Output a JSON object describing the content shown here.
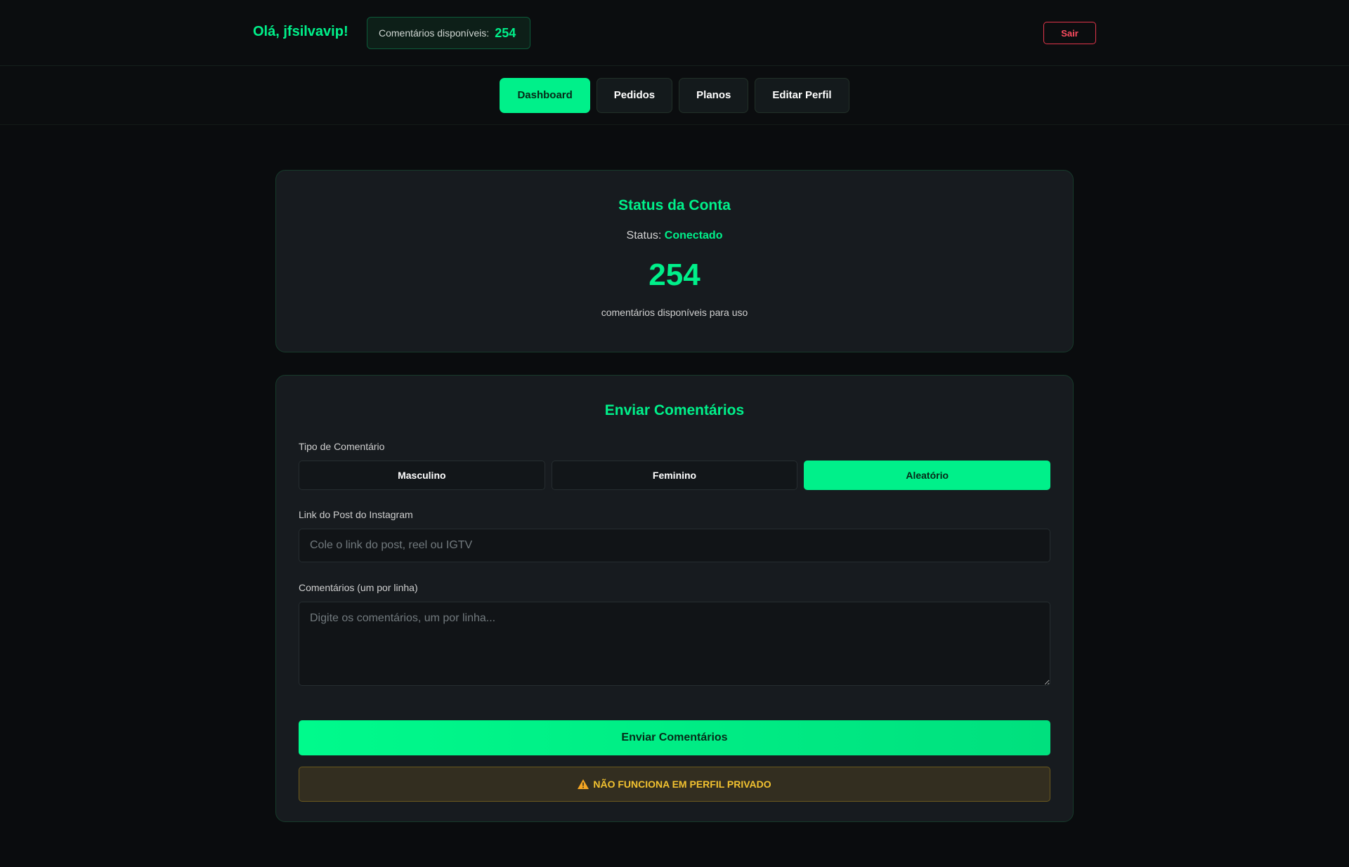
{
  "header": {
    "greeting": "Olá, jfsilvavip!",
    "credits_label": "Comentários disponíveis:",
    "credits_value": "254",
    "logout_label": "Sair"
  },
  "nav": {
    "tabs": [
      {
        "label": "Dashboard",
        "active": true
      },
      {
        "label": "Pedidos",
        "active": false
      },
      {
        "label": "Planos",
        "active": false
      },
      {
        "label": "Editar Perfil",
        "active": false
      }
    ]
  },
  "status_card": {
    "title": "Status da Conta",
    "status_label": "Status:",
    "status_value": "Conectado",
    "count": "254",
    "count_caption": "comentários disponíveis para uso"
  },
  "send_card": {
    "title": "Enviar Comentários",
    "type_label": "Tipo de Comentário",
    "types": [
      {
        "label": "Masculino",
        "active": false
      },
      {
        "label": "Feminino",
        "active": false
      },
      {
        "label": "Aleatório",
        "active": true
      }
    ],
    "link_label": "Link do Post do Instagram",
    "link_placeholder": "Cole o link do post, reel ou IGTV",
    "link_value": "",
    "comments_label": "Comentários (um por linha)",
    "comments_placeholder": "Digite os comentários, um por linha...",
    "comments_value": "",
    "submit_label": "Enviar Comentários",
    "warning_icon": "warning-triangle-icon",
    "warning_text": "NÃO FUNCIONA EM PERFIL PRIVADO"
  },
  "colors": {
    "accent": "#00f08a",
    "background": "#0a0c0e",
    "card": "#171b1f",
    "danger": "#ff4c60",
    "warning": "#f2c230"
  }
}
